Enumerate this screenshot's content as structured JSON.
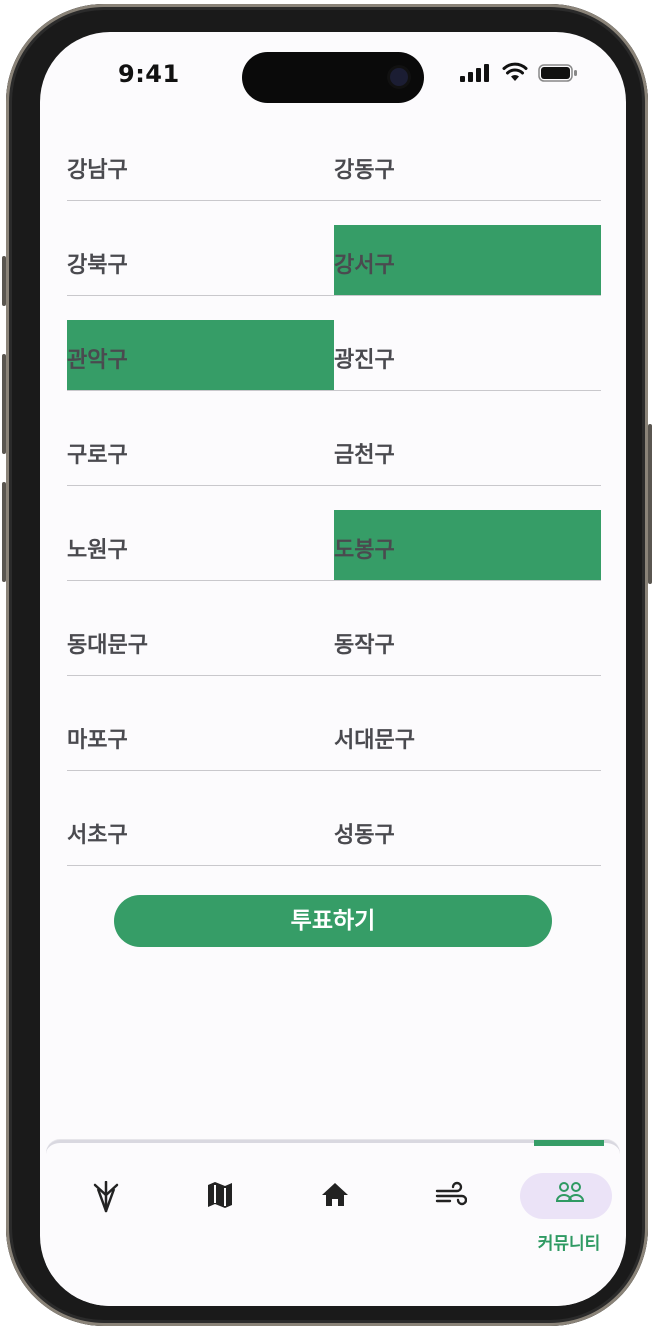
{
  "status": {
    "time": "9:41"
  },
  "districts": [
    {
      "name": "강남구",
      "selected": false
    },
    {
      "name": "강동구",
      "selected": false
    },
    {
      "name": "강북구",
      "selected": false
    },
    {
      "name": "강서구",
      "selected": true
    },
    {
      "name": "관악구",
      "selected": true
    },
    {
      "name": "광진구",
      "selected": false
    },
    {
      "name": "구로구",
      "selected": false
    },
    {
      "name": "금천구",
      "selected": false
    },
    {
      "name": "노원구",
      "selected": false
    },
    {
      "name": "도봉구",
      "selected": true
    },
    {
      "name": "동대문구",
      "selected": false
    },
    {
      "name": "동작구",
      "selected": false
    },
    {
      "name": "마포구",
      "selected": false
    },
    {
      "name": "서대문구",
      "selected": false
    },
    {
      "name": "서초구",
      "selected": false
    },
    {
      "name": "성동구",
      "selected": false
    }
  ],
  "vote_button": {
    "label": "투표하기"
  },
  "colors": {
    "accent": "#369d67",
    "active_pill": "#ebe3f7",
    "text": "#4a4a4f"
  },
  "tabbar": {
    "tabs": [
      {
        "icon": "umbrella-icon",
        "label": ""
      },
      {
        "icon": "map-icon",
        "label": ""
      },
      {
        "icon": "home-icon",
        "label": ""
      },
      {
        "icon": "wind-icon",
        "label": ""
      },
      {
        "icon": "community-icon",
        "label": "커뮤니티",
        "active": true
      }
    ]
  }
}
